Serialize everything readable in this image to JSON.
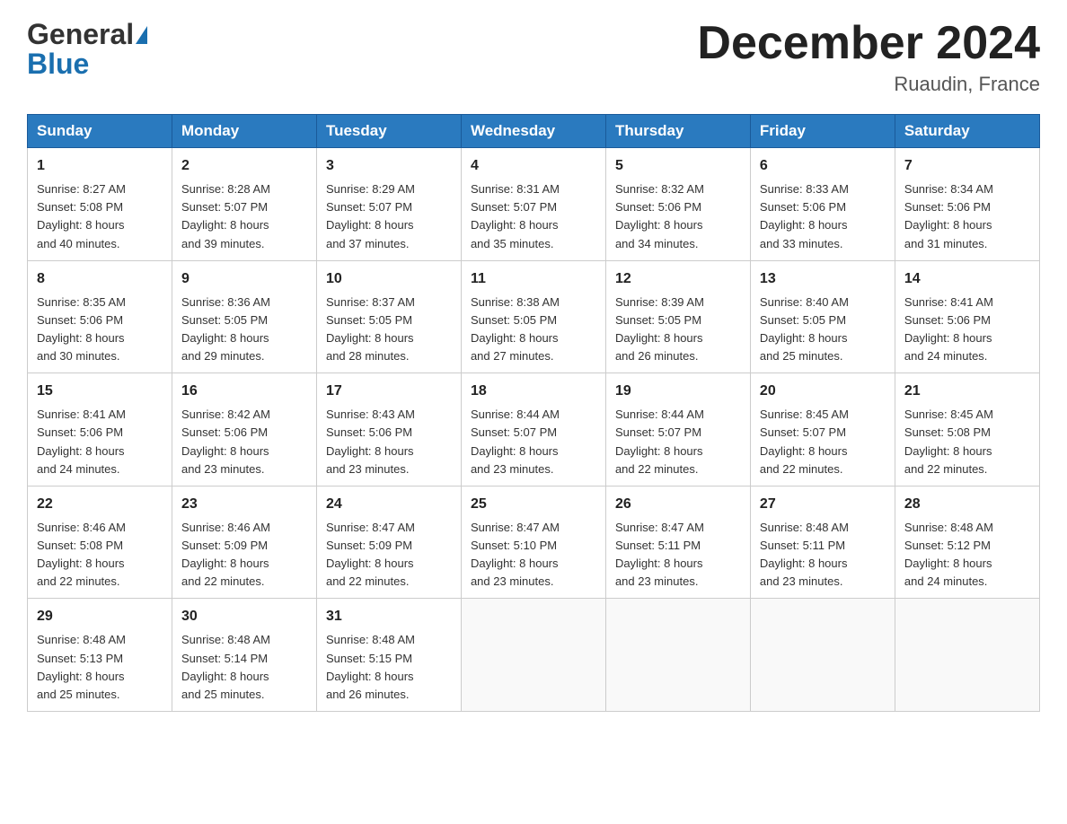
{
  "header": {
    "logo_general": "General",
    "logo_blue": "Blue",
    "month_title": "December 2024",
    "location": "Ruaudin, France"
  },
  "days_of_week": [
    "Sunday",
    "Monday",
    "Tuesday",
    "Wednesday",
    "Thursday",
    "Friday",
    "Saturday"
  ],
  "weeks": [
    [
      {
        "day": "1",
        "sunrise": "8:27 AM",
        "sunset": "5:08 PM",
        "daylight": "8 hours and 40 minutes."
      },
      {
        "day": "2",
        "sunrise": "8:28 AM",
        "sunset": "5:07 PM",
        "daylight": "8 hours and 39 minutes."
      },
      {
        "day": "3",
        "sunrise": "8:29 AM",
        "sunset": "5:07 PM",
        "daylight": "8 hours and 37 minutes."
      },
      {
        "day": "4",
        "sunrise": "8:31 AM",
        "sunset": "5:07 PM",
        "daylight": "8 hours and 35 minutes."
      },
      {
        "day": "5",
        "sunrise": "8:32 AM",
        "sunset": "5:06 PM",
        "daylight": "8 hours and 34 minutes."
      },
      {
        "day": "6",
        "sunrise": "8:33 AM",
        "sunset": "5:06 PM",
        "daylight": "8 hours and 33 minutes."
      },
      {
        "day": "7",
        "sunrise": "8:34 AM",
        "sunset": "5:06 PM",
        "daylight": "8 hours and 31 minutes."
      }
    ],
    [
      {
        "day": "8",
        "sunrise": "8:35 AM",
        "sunset": "5:06 PM",
        "daylight": "8 hours and 30 minutes."
      },
      {
        "day": "9",
        "sunrise": "8:36 AM",
        "sunset": "5:05 PM",
        "daylight": "8 hours and 29 minutes."
      },
      {
        "day": "10",
        "sunrise": "8:37 AM",
        "sunset": "5:05 PM",
        "daylight": "8 hours and 28 minutes."
      },
      {
        "day": "11",
        "sunrise": "8:38 AM",
        "sunset": "5:05 PM",
        "daylight": "8 hours and 27 minutes."
      },
      {
        "day": "12",
        "sunrise": "8:39 AM",
        "sunset": "5:05 PM",
        "daylight": "8 hours and 26 minutes."
      },
      {
        "day": "13",
        "sunrise": "8:40 AM",
        "sunset": "5:05 PM",
        "daylight": "8 hours and 25 minutes."
      },
      {
        "day": "14",
        "sunrise": "8:41 AM",
        "sunset": "5:06 PM",
        "daylight": "8 hours and 24 minutes."
      }
    ],
    [
      {
        "day": "15",
        "sunrise": "8:41 AM",
        "sunset": "5:06 PM",
        "daylight": "8 hours and 24 minutes."
      },
      {
        "day": "16",
        "sunrise": "8:42 AM",
        "sunset": "5:06 PM",
        "daylight": "8 hours and 23 minutes."
      },
      {
        "day": "17",
        "sunrise": "8:43 AM",
        "sunset": "5:06 PM",
        "daylight": "8 hours and 23 minutes."
      },
      {
        "day": "18",
        "sunrise": "8:44 AM",
        "sunset": "5:07 PM",
        "daylight": "8 hours and 23 minutes."
      },
      {
        "day": "19",
        "sunrise": "8:44 AM",
        "sunset": "5:07 PM",
        "daylight": "8 hours and 22 minutes."
      },
      {
        "day": "20",
        "sunrise": "8:45 AM",
        "sunset": "5:07 PM",
        "daylight": "8 hours and 22 minutes."
      },
      {
        "day": "21",
        "sunrise": "8:45 AM",
        "sunset": "5:08 PM",
        "daylight": "8 hours and 22 minutes."
      }
    ],
    [
      {
        "day": "22",
        "sunrise": "8:46 AM",
        "sunset": "5:08 PM",
        "daylight": "8 hours and 22 minutes."
      },
      {
        "day": "23",
        "sunrise": "8:46 AM",
        "sunset": "5:09 PM",
        "daylight": "8 hours and 22 minutes."
      },
      {
        "day": "24",
        "sunrise": "8:47 AM",
        "sunset": "5:09 PM",
        "daylight": "8 hours and 22 minutes."
      },
      {
        "day": "25",
        "sunrise": "8:47 AM",
        "sunset": "5:10 PM",
        "daylight": "8 hours and 23 minutes."
      },
      {
        "day": "26",
        "sunrise": "8:47 AM",
        "sunset": "5:11 PM",
        "daylight": "8 hours and 23 minutes."
      },
      {
        "day": "27",
        "sunrise": "8:48 AM",
        "sunset": "5:11 PM",
        "daylight": "8 hours and 23 minutes."
      },
      {
        "day": "28",
        "sunrise": "8:48 AM",
        "sunset": "5:12 PM",
        "daylight": "8 hours and 24 minutes."
      }
    ],
    [
      {
        "day": "29",
        "sunrise": "8:48 AM",
        "sunset": "5:13 PM",
        "daylight": "8 hours and 25 minutes."
      },
      {
        "day": "30",
        "sunrise": "8:48 AM",
        "sunset": "5:14 PM",
        "daylight": "8 hours and 25 minutes."
      },
      {
        "day": "31",
        "sunrise": "8:48 AM",
        "sunset": "5:15 PM",
        "daylight": "8 hours and 26 minutes."
      },
      null,
      null,
      null,
      null
    ]
  ],
  "labels": {
    "sunrise_prefix": "Sunrise: ",
    "sunset_prefix": "Sunset: ",
    "daylight_prefix": "Daylight: "
  }
}
